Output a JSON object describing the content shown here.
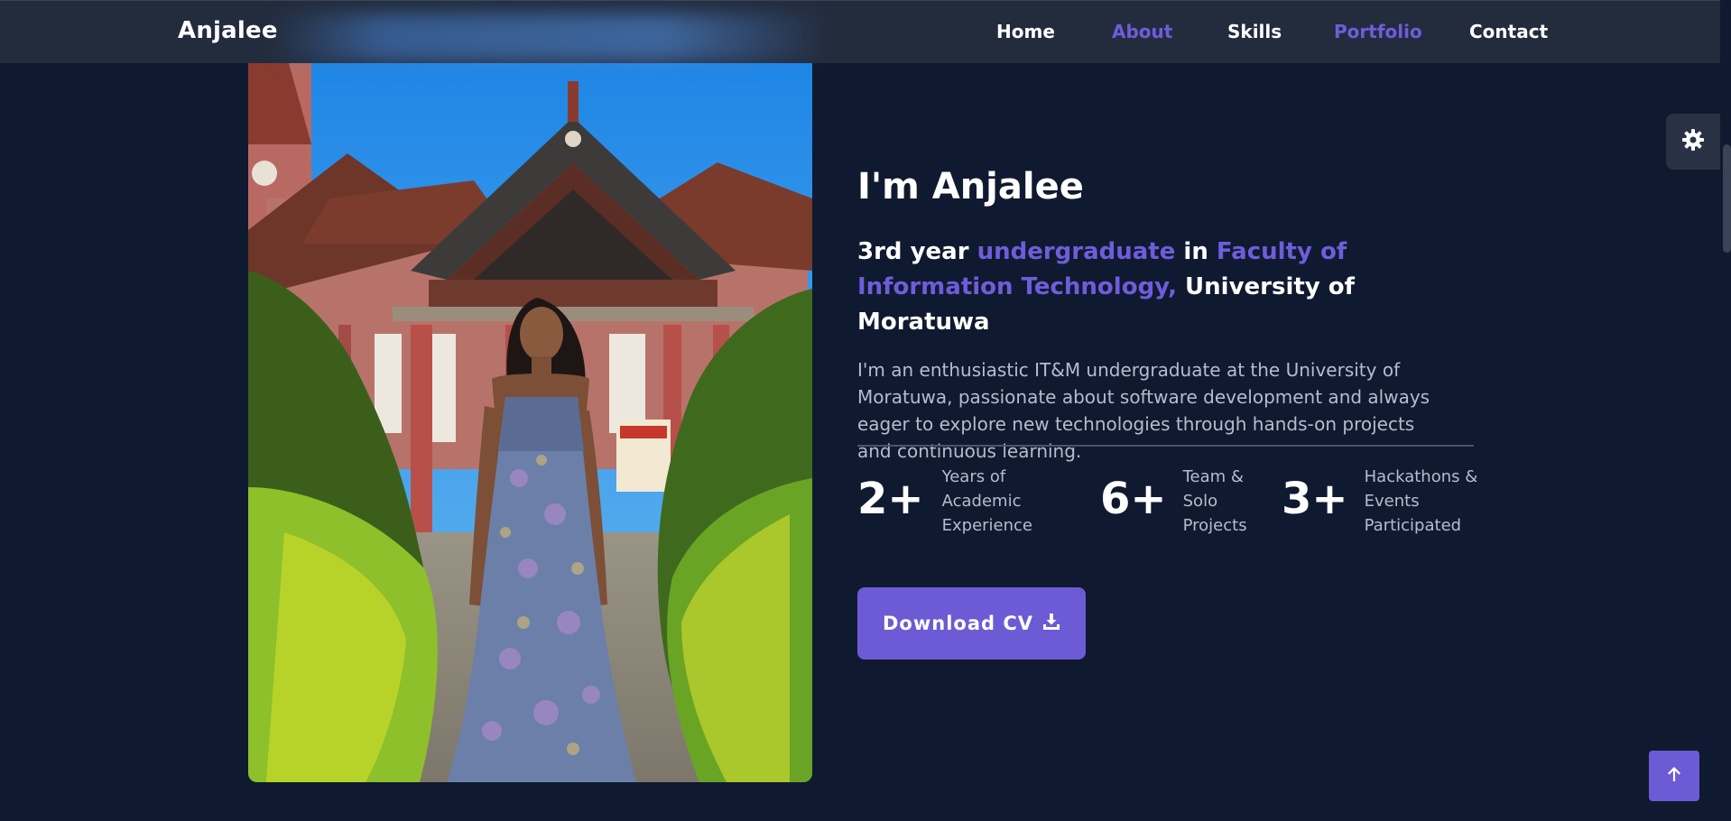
{
  "nav": {
    "logo": "Anjalee",
    "links": [
      {
        "label": "Home",
        "active": false
      },
      {
        "label": "About",
        "active": true
      },
      {
        "label": "Skills",
        "active": false
      },
      {
        "label": "Portfolio",
        "active": true
      },
      {
        "label": "Contact",
        "active": false
      }
    ]
  },
  "hero": {
    "title": "I'm Anjalee",
    "subtitle_parts": [
      "3rd year ",
      "undergraduate",
      " in ",
      "Faculty of Information Technology,",
      " University of Moratuwa"
    ],
    "description": "I'm an enthusiastic IT&M undergraduate at the University of Moratuwa, passionate about software development and always eager to explore new technologies through hands-on projects and continuous learning."
  },
  "stats": [
    {
      "number": "2+",
      "label_lines": [
        "Years of",
        "Academic",
        "Experience"
      ]
    },
    {
      "number": "6+",
      "label_lines": [
        "Team &",
        "Solo",
        "Projects"
      ]
    },
    {
      "number": "3+",
      "label_lines": [
        "Hackathons &",
        "Events",
        "Participated"
      ]
    }
  ],
  "cv_button": {
    "label": "Download CV",
    "icon": "download-icon"
  },
  "icons": {
    "theme": "gear-icon",
    "back_to_top": "arrow-up-icon"
  },
  "colors": {
    "accent": "#6e5ddb",
    "background": "#0f1a30",
    "navbar": "#232c3d",
    "button": "#6c5bd4"
  }
}
